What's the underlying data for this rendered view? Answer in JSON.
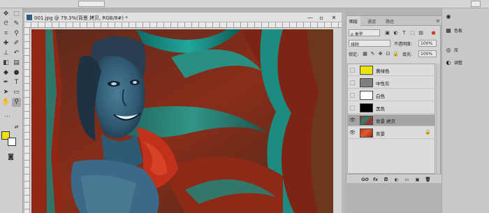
{
  "document": {
    "title": "001.jpg @ 79.3%(背景 拷贝, RGB/8#) *"
  },
  "window_controls": {
    "minimize": "—",
    "restore": "▫",
    "close": "✕"
  },
  "colors": {
    "foreground": "#f2e20f",
    "background": "#ffffff"
  },
  "layers_panel": {
    "tabs": [
      {
        "label": "图层",
        "active": true
      },
      {
        "label": "通道",
        "active": false
      },
      {
        "label": "路径",
        "active": false
      }
    ],
    "filter_kind": "ρ 类型",
    "blend_mode": "排除",
    "opacity_label": "不透明度:",
    "opacity_value": "100%",
    "lock_label": "锁定:",
    "fill_label": "填充:",
    "fill_value": "100%",
    "layers": [
      {
        "name": "黄绿色",
        "thumb": "#e9e20d",
        "visible": false,
        "selected": false,
        "locked": false
      },
      {
        "name": "中性灰",
        "thumb": "#808080",
        "visible": false,
        "selected": false,
        "locked": false
      },
      {
        "name": "白色",
        "thumb": "#ffffff",
        "visible": false,
        "selected": false,
        "locked": false
      },
      {
        "name": "黑色",
        "thumb": "#000000",
        "visible": false,
        "selected": false,
        "locked": false
      },
      {
        "name": "背景 拷贝",
        "thumb": "#b4291a",
        "visible": true,
        "selected": true,
        "locked": false
      },
      {
        "name": "背景",
        "thumb": "#c4311d",
        "visible": true,
        "selected": false,
        "locked": true
      }
    ],
    "footer_icons": [
      "GO",
      "fx",
      "◘",
      "◐",
      "▭",
      "▣",
      "🗑"
    ]
  },
  "right_dock": [
    {
      "icon": "◉",
      "label": ""
    },
    {
      "icon": "▦",
      "label": "色板"
    },
    {
      "icon": "◎",
      "label": "库"
    },
    {
      "icon": "◐",
      "label": "调整"
    }
  ]
}
